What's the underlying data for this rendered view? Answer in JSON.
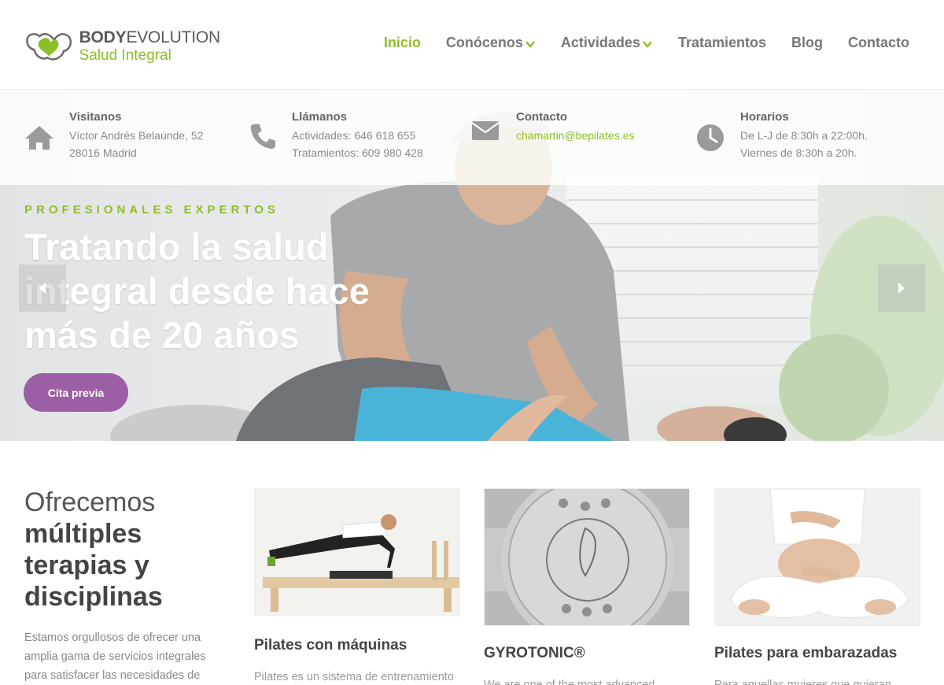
{
  "brand": {
    "name_bold": "BODY",
    "name_light": "EVOLUTION",
    "tagline": "Salud Integral",
    "colors": {
      "green": "#8cbf26",
      "purple": "#9c5ea5",
      "gray": "#777777"
    }
  },
  "nav": {
    "items": [
      {
        "label": "Inicio",
        "active": true,
        "dropdown": false
      },
      {
        "label": "Conócenos",
        "active": false,
        "dropdown": true
      },
      {
        "label": "Actividades",
        "active": false,
        "dropdown": true
      },
      {
        "label": "Tratamientos",
        "active": false,
        "dropdown": false
      },
      {
        "label": "Blog",
        "active": false,
        "dropdown": false
      },
      {
        "label": "Contacto",
        "active": false,
        "dropdown": false
      }
    ]
  },
  "info": {
    "visit": {
      "icon": "home-icon",
      "title": "Visitanos",
      "line1": "Víctor Andrés Belaúnde, 52",
      "line2": "28016 Madrid"
    },
    "call": {
      "icon": "phone-icon",
      "title": "Llámanos",
      "line1": "Actividades: 646 618 655",
      "line2": "Tratamientos: 609 980 428"
    },
    "contact": {
      "icon": "envelope-icon",
      "title": "Contacto",
      "line1": "chamartin@bepilates.es"
    },
    "hours": {
      "icon": "clock-icon",
      "title": "Horarios",
      "line1": "De L-J de 8:30h a 22:00h.",
      "line2": "Viernes de 8:30h a 20h."
    }
  },
  "hero": {
    "kicker": "PROFESIONALES EXPERTOS",
    "title": "Tratando la salud integral desde hace más de 20 años",
    "button": "Cita previa"
  },
  "offer": {
    "heading_light": "Ofrecemos",
    "heading_bold": "múltiples terapias y disciplinas",
    "text": "Estamos orgullosos de ofrecer una amplia gama de servicios integrales para satisfacer las necesidades de"
  },
  "cards": [
    {
      "title": "Pilates con máquinas",
      "text": "Pilates es un sistema de entrenamiento"
    },
    {
      "title": "GYROTONIC®",
      "text": "We are one of the most advanced"
    },
    {
      "title": "Pilates para embarazadas",
      "text": "Para aquellas mujeres que quieran"
    }
  ]
}
